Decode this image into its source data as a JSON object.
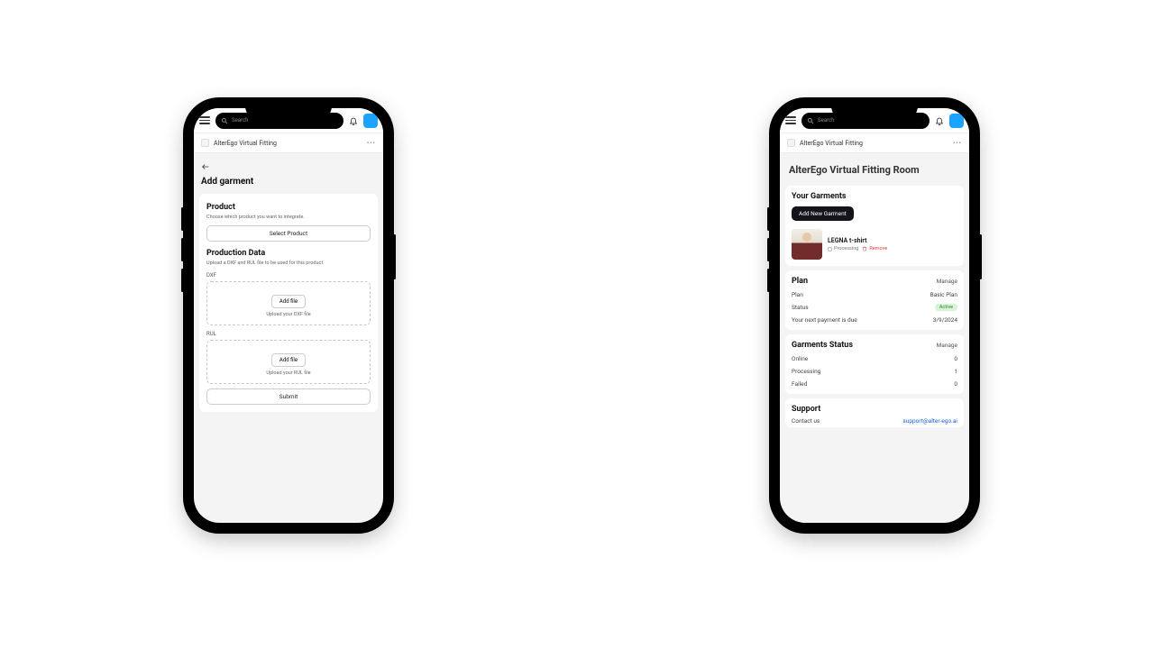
{
  "topbar": {
    "search_placeholder": "Search",
    "app_name": "AlterEgo Virtual Fitting"
  },
  "left": {
    "page_title": "Add garment",
    "product": {
      "title": "Product",
      "description": "Choose which product you want to integrate.",
      "select_button": "Select Product"
    },
    "production_data": {
      "title": "Production Data",
      "description": "Upload a DXF and RUL file to be used for this product.",
      "dxf_label": "DXF",
      "rul_label": "RUL",
      "add_file": "Add file",
      "dxf_hint": "Upload your DXF file",
      "rul_hint": "Upload your RUL file",
      "submit": "Submit"
    }
  },
  "right": {
    "room_title": "AlterEgo Virtual Fitting Room",
    "garments": {
      "title": "Your Garments",
      "add_button": "Add New Garment",
      "item_name": "LEGNA t-shirt",
      "item_status": "Processing",
      "remove": "Remove"
    },
    "plan": {
      "title": "Plan",
      "manage": "Manage",
      "plan_label": "Plan",
      "plan_value": "Basic Plan",
      "status_label": "Status",
      "status_value": "Active",
      "next_label": "Your next payment is due",
      "next_value": "3/9/2024"
    },
    "status": {
      "title": "Garments Status",
      "manage": "Manage",
      "online_label": "Online",
      "online_value": "0",
      "processing_label": "Processing",
      "processing_value": "1",
      "failed_label": "Failed",
      "failed_value": "0"
    },
    "support": {
      "title": "Support",
      "contact_label": "Contact us",
      "email": "support@alter-ego.ai"
    }
  }
}
